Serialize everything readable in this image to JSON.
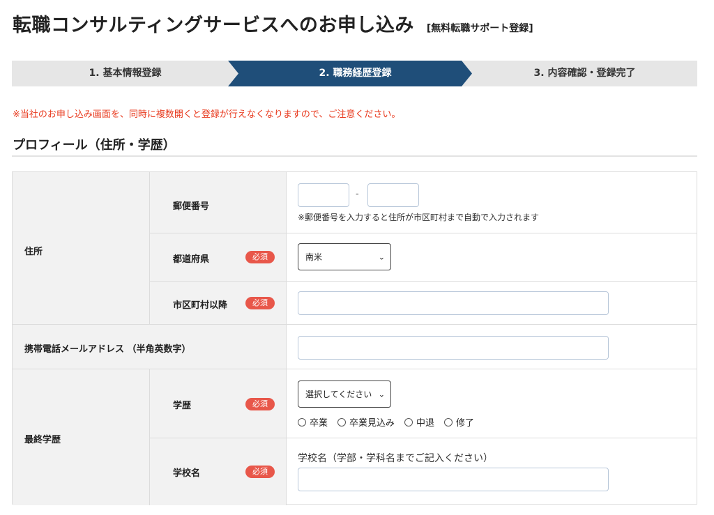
{
  "header": {
    "title": "転職コンサルティングサービスへのお申し込み",
    "subtitle": "[無料転職サポート登録]"
  },
  "steps": [
    {
      "label": "1. 基本情報登録",
      "active": false
    },
    {
      "label": "2. 職務経歴登録",
      "active": true
    },
    {
      "label": "3. 内容確認・登録完了",
      "active": false
    }
  ],
  "colors": {
    "active_step": "#1f4e79",
    "inactive_step": "#e6e6e6",
    "notice": "#e8391d",
    "required_badge": "#e8574a"
  },
  "notice": "※当社のお申し込み画面を、同時に複数開くと登録が行えなくなりますので、ご注意ください。",
  "section": {
    "heading": "プロフィール（住所・学歴）"
  },
  "form": {
    "required_label": "必須",
    "address": {
      "group_label": "住所",
      "postal": {
        "label": "郵便番号",
        "separator": "-",
        "hint": "※郵便番号を入力すると住所が市区町村まで自動で入力されます",
        "value1": "",
        "value2": ""
      },
      "prefecture": {
        "label": "都道府県",
        "selected": "南米"
      },
      "city": {
        "label": "市区町村以降",
        "value": ""
      }
    },
    "email": {
      "label": "携帯電話メールアドレス （半角英数字）",
      "value": ""
    },
    "education": {
      "group_label": "最終学歴",
      "level": {
        "label": "学歴",
        "selected": "選択してください",
        "options": [
          "卒業",
          "卒業見込み",
          "中退",
          "修了"
        ]
      },
      "school": {
        "label": "学校名",
        "caption": "学校名（学部・学科名までご記入ください）",
        "value": ""
      }
    }
  }
}
